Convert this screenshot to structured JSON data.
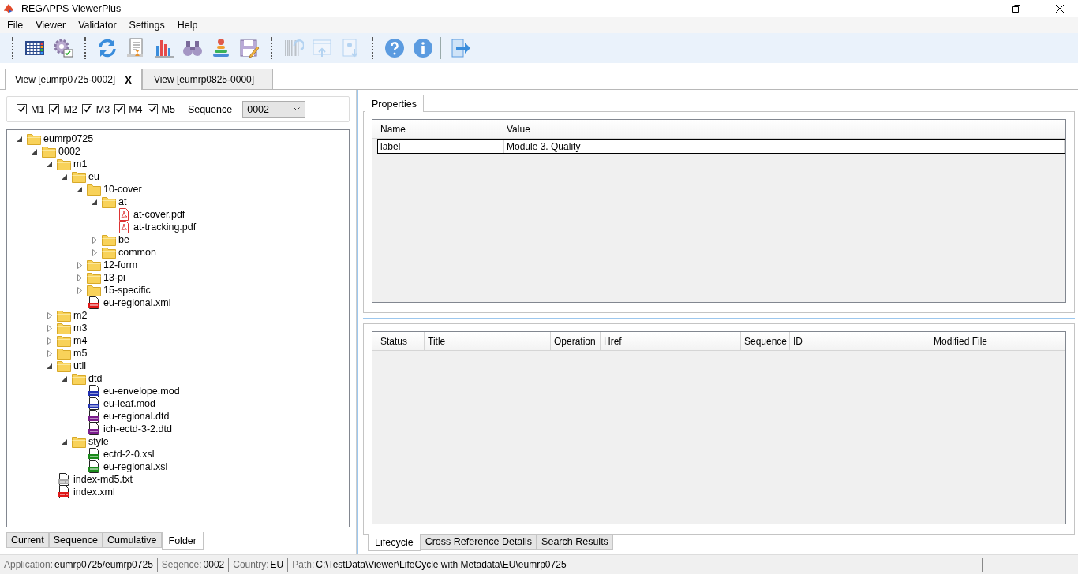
{
  "window": {
    "title": "REGAPPS ViewerPlus"
  },
  "menu": [
    "File",
    "Viewer",
    "Validator",
    "Settings",
    "Help"
  ],
  "toolbar": {
    "groups": [
      {
        "kind": "grip",
        "items": [
          {
            "kind": "grid",
            "disabled": false
          },
          {
            "kind": "gear",
            "disabled": false
          }
        ]
      },
      {
        "kind": "grip",
        "items": [
          {
            "kind": "refresh",
            "disabled": false
          },
          {
            "kind": "report",
            "disabled": false
          },
          {
            "kind": "chart",
            "disabled": false
          },
          {
            "kind": "binoculars",
            "disabled": false
          },
          {
            "kind": "stack",
            "disabled": false
          },
          {
            "kind": "save",
            "disabled": false
          }
        ]
      },
      {
        "kind": "grip",
        "items": [
          {
            "kind": "barcode",
            "disabled": true
          },
          {
            "kind": "upload",
            "disabled": true
          },
          {
            "kind": "download",
            "disabled": true
          }
        ]
      },
      {
        "kind": "grip",
        "items": [
          {
            "kind": "help",
            "disabled": false
          },
          {
            "kind": "info",
            "disabled": false
          }
        ]
      },
      {
        "kind": "line",
        "items": [
          {
            "kind": "exit",
            "disabled": false
          }
        ]
      }
    ]
  },
  "document_tabs": [
    {
      "label": "View [eumrp0725-0002]",
      "selected": true,
      "close": "X"
    },
    {
      "label": "View [eumrp0825-0000]",
      "selected": false
    }
  ],
  "filters": {
    "modules": [
      {
        "label": "M1",
        "checked": true
      },
      {
        "label": "M2",
        "checked": true
      },
      {
        "label": "M3",
        "checked": true
      },
      {
        "label": "M4",
        "checked": true
      },
      {
        "label": "M5",
        "checked": true
      }
    ],
    "sequence": {
      "label": "Sequence",
      "value": "0002"
    }
  },
  "tree": [
    {
      "kind": "folder",
      "label": "eumrp0725",
      "expanded": true,
      "children": [
        {
          "kind": "folder",
          "label": "0002",
          "expanded": true,
          "children": [
            {
              "kind": "folder",
              "label": "m1",
              "expanded": true,
              "children": [
                {
                  "kind": "folder",
                  "label": "eu",
                  "expanded": true,
                  "children": [
                    {
                      "kind": "folder",
                      "label": "10-cover",
                      "expanded": true,
                      "children": [
                        {
                          "kind": "folder",
                          "label": "at",
                          "expanded": true,
                          "children": [
                            {
                              "kind": "pdf",
                              "label": "at-cover.pdf"
                            },
                            {
                              "kind": "pdf",
                              "label": "at-tracking.pdf"
                            }
                          ]
                        },
                        {
                          "kind": "folder",
                          "label": "be",
                          "expanded": false
                        },
                        {
                          "kind": "folder",
                          "label": "common",
                          "expanded": false
                        }
                      ]
                    },
                    {
                      "kind": "folder",
                      "label": "12-form",
                      "expanded": false
                    },
                    {
                      "kind": "folder",
                      "label": "13-pi",
                      "expanded": false
                    },
                    {
                      "kind": "folder",
                      "label": "15-specific",
                      "expanded": false
                    },
                    {
                      "kind": "xml",
                      "label": "eu-regional.xml"
                    }
                  ]
                }
              ]
            },
            {
              "kind": "folder",
              "label": "m2",
              "expanded": false
            },
            {
              "kind": "folder",
              "label": "m3",
              "expanded": false
            },
            {
              "kind": "folder",
              "label": "m4",
              "expanded": false
            },
            {
              "kind": "folder",
              "label": "m5",
              "expanded": false
            },
            {
              "kind": "folder",
              "label": "util",
              "expanded": true,
              "children": [
                {
                  "kind": "folder",
                  "label": "dtd",
                  "expanded": true,
                  "children": [
                    {
                      "kind": "mod",
                      "label": "eu-envelope.mod"
                    },
                    {
                      "kind": "mod",
                      "label": "eu-leaf.mod"
                    },
                    {
                      "kind": "dtd",
                      "label": "eu-regional.dtd"
                    },
                    {
                      "kind": "dtd",
                      "label": "ich-ectd-3-2.dtd"
                    }
                  ]
                },
                {
                  "kind": "folder",
                  "label": "style",
                  "expanded": true,
                  "children": [
                    {
                      "kind": "xsl",
                      "label": "ectd-2-0.xsl"
                    },
                    {
                      "kind": "xsl",
                      "label": "eu-regional.xsl"
                    }
                  ]
                }
              ]
            },
            {
              "kind": "txt",
              "label": "index-md5.txt"
            },
            {
              "kind": "xml",
              "label": "index.xml"
            }
          ]
        }
      ]
    }
  ],
  "view_tabs": [
    {
      "label": "Current",
      "selected": false
    },
    {
      "label": "Sequence",
      "selected": false
    },
    {
      "label": "Cumulative",
      "selected": false
    },
    {
      "label": "Folder",
      "selected": true
    }
  ],
  "properties": {
    "tab": {
      "label": "Properties",
      "selected": true
    },
    "columns": [
      "Name",
      "Value"
    ],
    "rows": [
      {
        "cells": [
          "label",
          "Module 3. Quality"
        ],
        "selected": true
      }
    ]
  },
  "lifecycle": {
    "columns": [
      "Status",
      "Title",
      "Operation",
      "Href",
      "Sequence",
      "ID",
      "Modified File"
    ]
  },
  "detail_tabs": [
    {
      "label": "Lifecycle",
      "selected": true
    },
    {
      "label": "Cross Reference Details",
      "selected": false
    },
    {
      "label": "Search Results",
      "selected": false
    }
  ],
  "status_bar": [
    {
      "label": "Application:",
      "value": "eumrp0725/eumrp0725"
    },
    {
      "label": "Seqence:",
      "value": "0002"
    },
    {
      "label": "Country:",
      "value": "EU"
    },
    {
      "label": "Path:",
      "value": "C:\\TestData\\Viewer\\LifeCycle with Metadata\\EU\\eumrp0725"
    }
  ]
}
